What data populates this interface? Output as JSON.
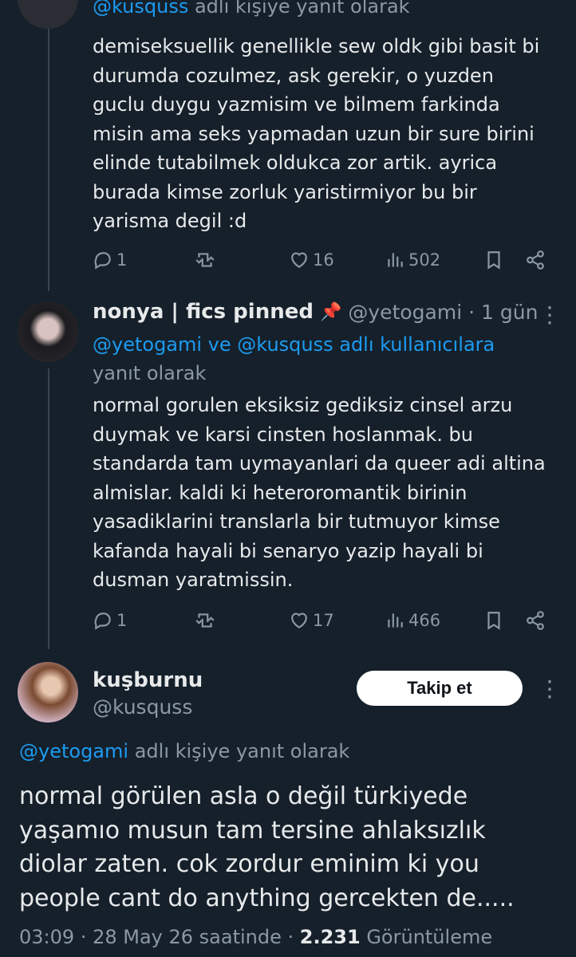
{
  "tweet1": {
    "reply_context_handle": "@kusquss",
    "reply_context_suffix": "adlı kişiye yanıt olarak",
    "text": "demiseksuellik genellikle sew oldk gibi basit bi\ndurumda cozulmez, ask gerekir, o yuzden\nguclu duygu yazmisim ve bilmem farkinda\nmisin ama seks yapmadan uzun bir sure birini\nelinde tutabilmek oldukca zor artik. ayrica\nburada kimse zorluk yaristirmiyor bu bir\nyarisma degil :d",
    "replies": "1",
    "likes": "16",
    "views": "502"
  },
  "tweet2": {
    "display_name": "nonya | fics pinned",
    "pin_emoji": "📌",
    "handle": "@yetogami",
    "time": "· 1 gün",
    "reply_context_links": "@yetogami ve @kusquss adlı kullanıcılara",
    "reply_context_suffix": "yanıt olarak",
    "text": "normal gorulen eksiksiz gediksiz cinsel arzu\nduymak ve karsi cinsten hoslanmak. bu\nstandarda tam uymayanlari da queer adi altina\nalmislar. kaldi ki heteroromantik birinin\nyasadiklarini translarla bir tutmuyor kimse\nkafanda hayali bi senaryo yazip hayali bi\ndusman yaratmissin.",
    "replies": "1",
    "likes": "17",
    "views": "466"
  },
  "main_tweet": {
    "display_name": "kuşburnu",
    "handle": "@kusquss",
    "follow_label": "Takip et",
    "reply_context_handle": "@yetogami",
    "reply_context_suffix": "adlı kişiye yanıt olarak",
    "text": "normal görülen asla o değil türkiyede\nyaşamıo musun tam tersine ahlaksızlık\ndiolar zaten. cok zordur eminim ki you\npeople cant do anything gercekten de.....",
    "time": "03:09",
    "date": "· 28 May 26 saatinde ·",
    "views_count": "2.231",
    "views_label": "Görüntüleme"
  },
  "icons": [
    "reply-icon",
    "retweet-icon",
    "like-icon",
    "views-icon",
    "bookmark-icon",
    "share-icon",
    "more-icon"
  ],
  "colors": {
    "background": "#15202b",
    "text": "#e7e9ea",
    "muted": "#8b98a5",
    "link": "#1d9bf0",
    "divider": "#38444d",
    "follow_bg": "#ffffff"
  }
}
